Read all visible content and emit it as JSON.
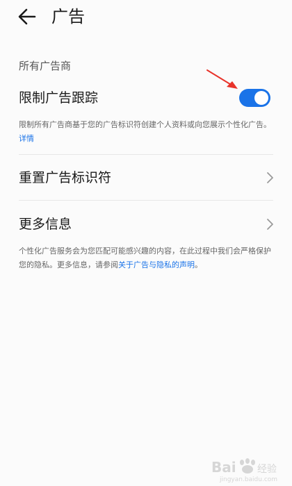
{
  "header": {
    "title": "广告"
  },
  "section": {
    "label": "所有广告商"
  },
  "limit_tracking": {
    "title": "限制广告跟踪",
    "enabled": true,
    "desc_text": "限制所有广告商基于您的广告标识符创建个人资料或向您展示个性化广告。",
    "desc_link": "详情"
  },
  "reset_id": {
    "title": "重置广告标识符"
  },
  "more_info": {
    "title": "更多信息",
    "desc_text": "个性化广告服务会为您匹配可能感兴趣的内容，在此过程中我们会严格保护您的隐私。更多信息，请参阅",
    "desc_link": "关于广告与隐私的声明",
    "desc_end": "。"
  },
  "watermark": {
    "text_main": "Bai",
    "text_sub": "经验",
    "url": "jingyan.baidu.com"
  },
  "colors": {
    "accent": "#1a73e8",
    "annotation": "#e8332a"
  }
}
